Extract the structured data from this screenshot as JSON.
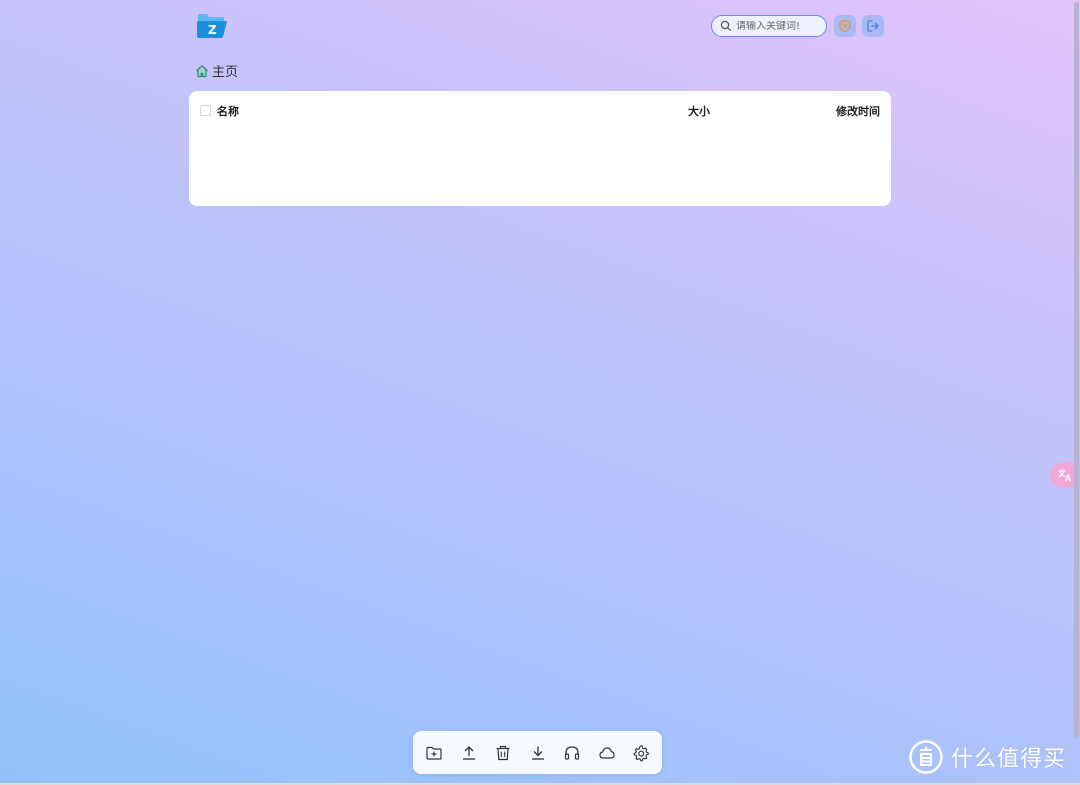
{
  "header": {
    "logo_icon": "folder-z-logo",
    "logo_letter": "Z",
    "search": {
      "placeholder": "请输入关键词!",
      "value": ""
    },
    "actions": [
      {
        "icon": "shield-icon",
        "color": "#e39a3a"
      },
      {
        "icon": "logout-icon",
        "color": "#4d7cf0"
      }
    ]
  },
  "breadcrumb": {
    "icon": "home-icon",
    "label": "主页"
  },
  "file_table": {
    "columns": {
      "name": "名称",
      "size": "大小",
      "modified": "修改时间"
    },
    "rows": []
  },
  "toolbar": {
    "tools": [
      "new-folder-icon",
      "upload-icon",
      "delete-icon",
      "download-icon",
      "headphones-icon",
      "cloud-icon",
      "settings-icon"
    ]
  },
  "side_widget": {
    "icon": "translate-icon"
  },
  "watermark": {
    "icon": "zhi-badge-icon",
    "text": "什么值得买"
  },
  "colors": {
    "gradient_top_right": "#e2c3fb",
    "gradient_bottom_left": "#92c2fb",
    "accent": "#4d7cf0",
    "logo_blue": "#1b8ee0"
  }
}
